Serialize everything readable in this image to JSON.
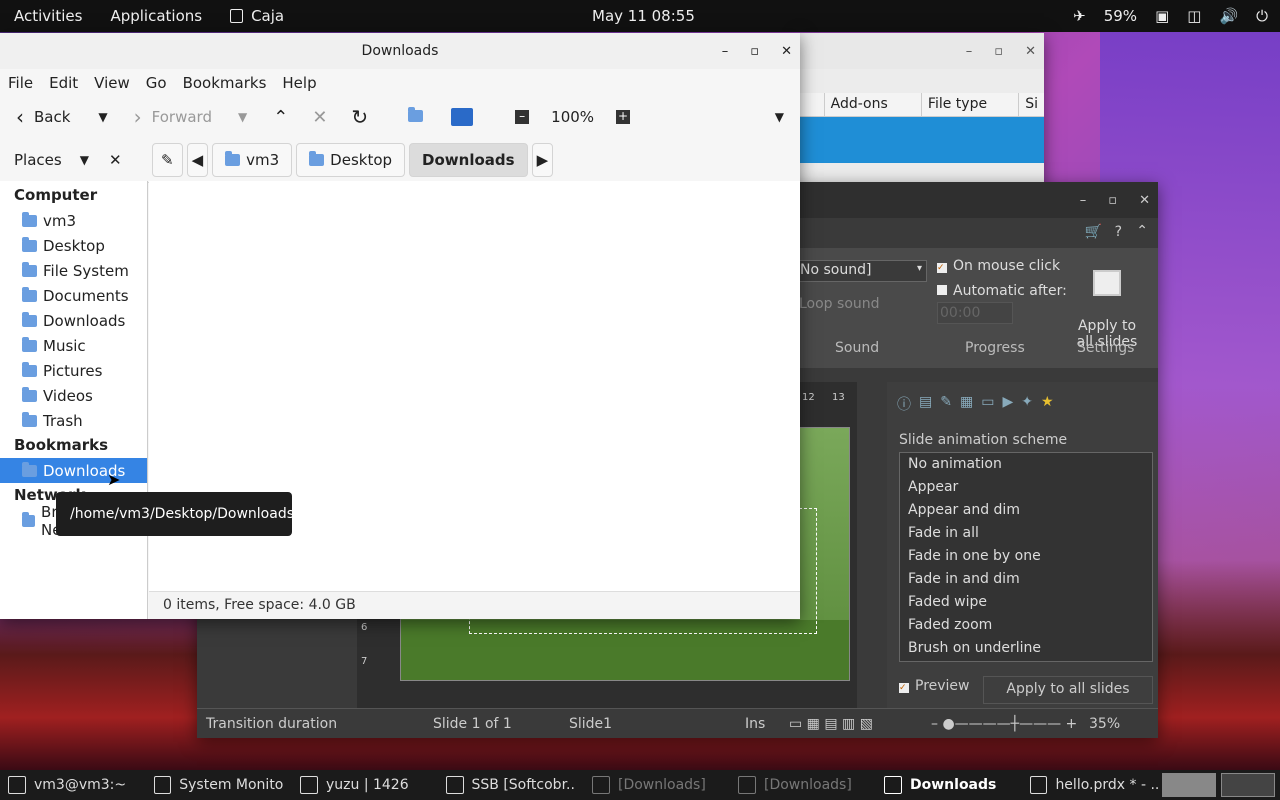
{
  "topbar": {
    "activities": "Activities",
    "applications": "Applications",
    "app_name": "Caja",
    "clock": "May 11  08:55",
    "battery": "59%"
  },
  "back_window": {
    "columns": [
      "Add-ons",
      "File type",
      "Si"
    ]
  },
  "impress": {
    "sound_select": "No sound]",
    "loop_sound": "Loop sound",
    "on_mouse_click": "On mouse click",
    "automatic_after": "Automatic after:",
    "time_value": "00:00",
    "apply_all": "Apply to\nall slides",
    "group_sound": "Sound",
    "group_progress": "Progress",
    "group_settings": "Settings",
    "ruler": [
      "12",
      "13"
    ],
    "vruler": [
      "6",
      "7"
    ],
    "panel_title": "Slide animation scheme",
    "animations": [
      "No animation",
      "Appear",
      "Appear and dim",
      "Fade in all",
      "Fade in one by one",
      "Fade in and dim",
      "Faded wipe",
      "Faded zoom",
      "Brush on underline"
    ],
    "preview": "Preview",
    "apply_all_btn": "Apply to all slides",
    "status": {
      "transition": "Transition duration",
      "slide": "Slide 1 of 1",
      "name": "Slide1",
      "ins": "Ins",
      "zoom": "35%"
    }
  },
  "caja": {
    "title": "Downloads",
    "menu": [
      "File",
      "Edit",
      "View",
      "Go",
      "Bookmarks",
      "Help"
    ],
    "back": "Back",
    "forward": "Forward",
    "zoom": "100%",
    "places": "Places",
    "crumbs": [
      "vm3",
      "Desktop",
      "Downloads"
    ],
    "sections": {
      "computer": "Computer",
      "bookmarks": "Bookmarks",
      "network": "Network"
    },
    "computer_items": [
      "vm3",
      "Desktop",
      "File System",
      "Documents",
      "Downloads",
      "Music",
      "Pictures",
      "Videos",
      "Trash"
    ],
    "bookmark_items": [
      "Downloads"
    ],
    "network_items": [
      "Browse Network"
    ],
    "status": "0 items, Free space: 4.0 GB",
    "tooltip": "/home/vm3/Desktop/Downloads"
  },
  "taskbar": [
    {
      "label": "vm3@vm3:~",
      "state": "normal"
    },
    {
      "label": "System Monitor",
      "state": "normal"
    },
    {
      "label": "yuzu | 1426",
      "state": "normal"
    },
    {
      "label": "SSB [Softcobr...",
      "state": "normal"
    },
    {
      "label": "[Downloads]",
      "state": "dim"
    },
    {
      "label": "[Downloads]",
      "state": "dim"
    },
    {
      "label": "Downloads",
      "state": "active"
    },
    {
      "label": "hello.prdx * - ...",
      "state": "normal"
    }
  ]
}
